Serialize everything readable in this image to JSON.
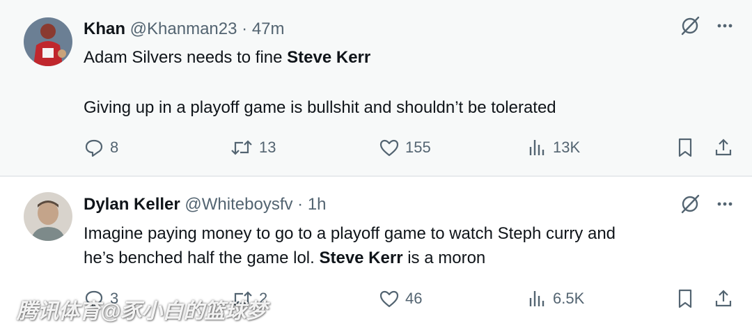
{
  "tweets": [
    {
      "name": "Khan",
      "handle": "@Khanman23",
      "separator": "·",
      "time": "47m",
      "text_before": "Adam Silvers needs to fine ",
      "text_bold": "Steve Kerr",
      "text_line2": "Giving up in a playoff game is bullshit and shouldn’t be tolerated",
      "replies": "8",
      "retweets": "13",
      "likes": "155",
      "views": "13K"
    },
    {
      "name": "Dylan Keller",
      "handle": "@Whiteboysfv",
      "separator": "·",
      "time": "1h",
      "text_line1": "Imagine paying money to go to a playoff game to watch Steph curry and",
      "text_line2_before": "he’s benched half the game lol. ",
      "text_bold": "Steve Kerr",
      "text_after": " is a moron",
      "replies": "3",
      "retweets": "2",
      "likes": "46",
      "views": "6.5K"
    }
  ],
  "watermark": "腾讯体育@豕小白的篮球梦",
  "colors": {
    "text": "#0f1419",
    "muted": "#536471",
    "bg_first": "#f7f9f9",
    "bg_second": "#ffffff"
  },
  "icons": [
    "grok-icon",
    "more-icon",
    "reply-icon",
    "retweet-icon",
    "like-icon",
    "views-icon",
    "bookmark-icon",
    "share-icon"
  ]
}
